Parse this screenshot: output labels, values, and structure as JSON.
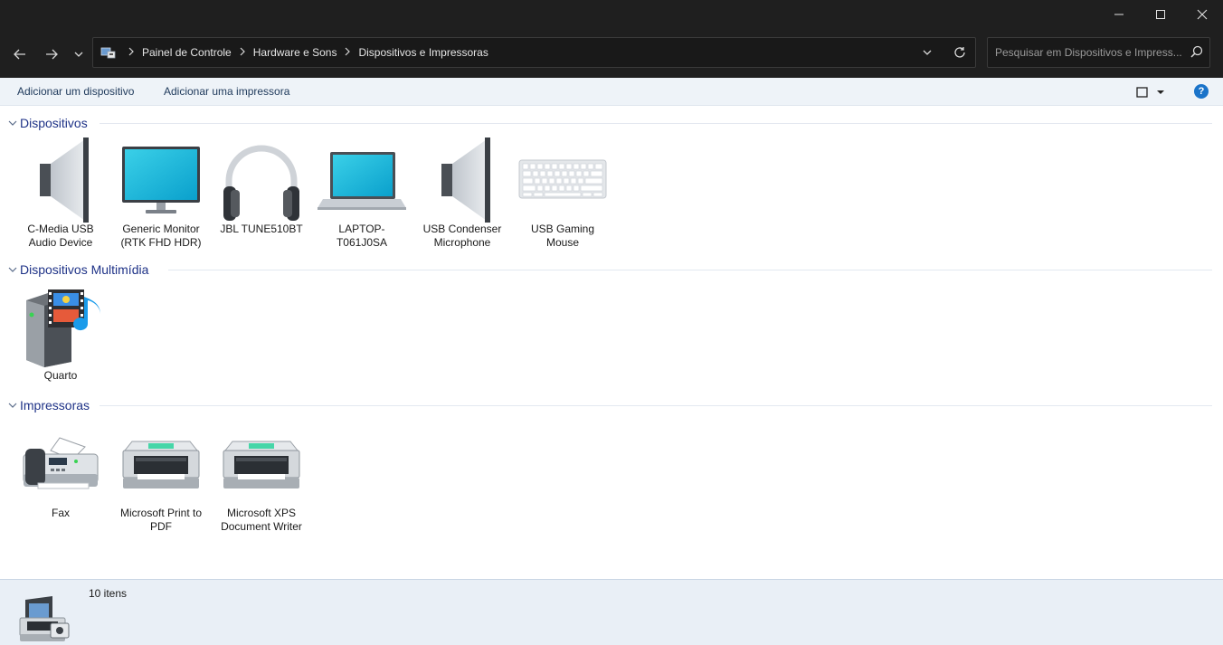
{
  "navigation": {
    "breadcrumbs": [
      "Painel de Controle",
      "Hardware e Sons",
      "Dispositivos e Impressoras"
    ],
    "search_placeholder": "Pesquisar em Dispositivos e Impress..."
  },
  "toolbar": {
    "add_device": "Adicionar um dispositivo",
    "add_printer": "Adicionar uma impressora",
    "help_label": "?"
  },
  "sections": [
    {
      "title": "Dispositivos",
      "items": [
        {
          "label": "C-Media USB Audio Device",
          "icon": "speaker-icon"
        },
        {
          "label": "Generic Monitor (RTK FHD HDR)",
          "icon": "monitor-icon"
        },
        {
          "label": "JBL TUNE510BT",
          "icon": "headphones-icon"
        },
        {
          "label": "LAPTOP-T061J0SA",
          "icon": "laptop-icon"
        },
        {
          "label": "USB Condenser Microphone",
          "icon": "speaker-icon"
        },
        {
          "label": "USB Gaming Mouse",
          "icon": "keyboard-icon"
        }
      ]
    },
    {
      "title": "Dispositivos Multimídia",
      "items": [
        {
          "label": "Quarto",
          "icon": "media-server-icon"
        }
      ]
    },
    {
      "title": "Impressoras",
      "items": [
        {
          "label": "Fax",
          "icon": "fax-icon"
        },
        {
          "label": "Microsoft Print to PDF",
          "icon": "printer-icon"
        },
        {
          "label": "Microsoft XPS Document Writer",
          "icon": "printer-icon"
        }
      ]
    }
  ],
  "status": {
    "item_count": "10 itens"
  },
  "colors": {
    "section_title": "#1e3287",
    "command_text": "#1e395b",
    "accent": "#1a73c9"
  }
}
